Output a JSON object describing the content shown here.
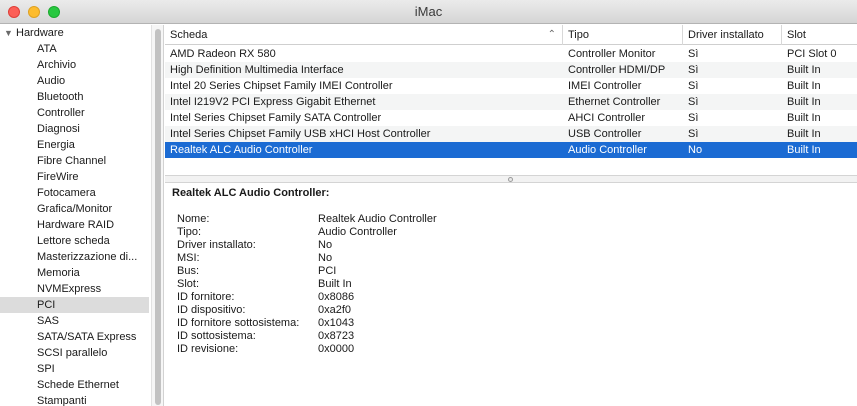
{
  "window": {
    "title": "iMac"
  },
  "sidebar": {
    "group_label": "Hardware",
    "items": [
      "ATA",
      "Archivio",
      "Audio",
      "Bluetooth",
      "Controller",
      "Diagnosi",
      "Energia",
      "Fibre Channel",
      "FireWire",
      "Fotocamera",
      "Grafica/Monitor",
      "Hardware RAID",
      "Lettore scheda",
      "Masterizzazione di...",
      "Memoria",
      "NVMExpress",
      "PCI",
      "SAS",
      "SATA/SATA Express",
      "SCSI parallelo",
      "SPI",
      "Schede Ethernet",
      "Stampanti"
    ],
    "selected": "PCI"
  },
  "table": {
    "headers": {
      "name": "Scheda",
      "type": "Tipo",
      "driver": "Driver installato",
      "slot": "Slot"
    },
    "rows": [
      {
        "name": "AMD Radeon RX 580",
        "type": "Controller Monitor",
        "driver": "Sì",
        "slot": "PCI Slot 0"
      },
      {
        "name": "High Definition Multimedia Interface",
        "type": "Controller HDMI/DP",
        "driver": "Sì",
        "slot": "Built In"
      },
      {
        "name": "Intel 20 Series Chipset Family IMEI Controller",
        "type": "IMEI Controller",
        "driver": "Sì",
        "slot": "Built In"
      },
      {
        "name": "Intel I219V2 PCI Express Gigabit Ethernet",
        "type": "Ethernet Controller",
        "driver": "Sì",
        "slot": "Built In"
      },
      {
        "name": "Intel Series Chipset Family SATA Controller",
        "type": "AHCI Controller",
        "driver": "Sì",
        "slot": "Built In"
      },
      {
        "name": "Intel Series Chipset Family USB xHCI Host Controller",
        "type": "USB Controller",
        "driver": "Sì",
        "slot": "Built In"
      },
      {
        "name": "Realtek ALC Audio Controller",
        "type": "Audio Controller",
        "driver": "No",
        "slot": "Built In"
      }
    ],
    "selected_index": 6
  },
  "detail": {
    "title": "Realtek ALC Audio Controller:",
    "properties": [
      {
        "label": "Nome:",
        "value": "Realtek Audio Controller"
      },
      {
        "label": "Tipo:",
        "value": "Audio Controller"
      },
      {
        "label": "Driver installato:",
        "value": "No"
      },
      {
        "label": "MSI:",
        "value": "No"
      },
      {
        "label": "Bus:",
        "value": "PCI"
      },
      {
        "label": "Slot:",
        "value": "Built In"
      },
      {
        "label": "ID fornitore:",
        "value": "0x8086"
      },
      {
        "label": "ID dispositivo:",
        "value": "0xa2f0"
      },
      {
        "label": "ID fornitore sottosistema:",
        "value": "0x1043"
      },
      {
        "label": "ID sottosistema:",
        "value": "0x8723"
      },
      {
        "label": "ID revisione:",
        "value": "0x0000"
      }
    ]
  },
  "colors": {
    "selection": "#1b6bd3",
    "sidebar_selection": "#dcdcdc"
  },
  "icons": {
    "disclosure": "disclosure-triangle-icon",
    "sort": "sort-ascending-icon"
  }
}
